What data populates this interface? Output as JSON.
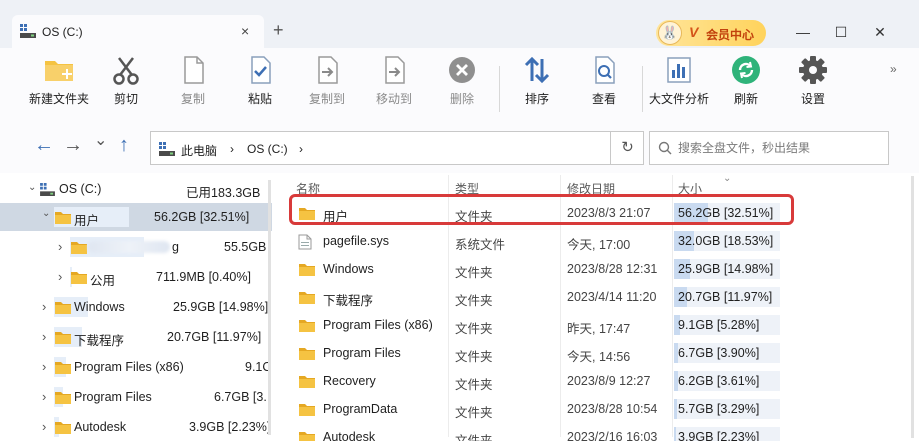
{
  "tab": {
    "title": "OS (C:)",
    "close": "×",
    "new_tab": "+"
  },
  "vip": {
    "rabbit": "🐰",
    "v": "V",
    "label": "会员中心"
  },
  "window": {
    "minimize": "—",
    "maximize": "☐",
    "close": "✕"
  },
  "toolbar": {
    "items": [
      {
        "label": "新建文件夹",
        "icon": "new-folder-icon",
        "enabled": true
      },
      {
        "label": "剪切",
        "icon": "scissors-icon",
        "enabled": true
      },
      {
        "label": "复制",
        "icon": "copy-icon",
        "enabled": false
      },
      {
        "label": "粘贴",
        "icon": "paste-icon",
        "enabled": true
      },
      {
        "label": "复制到",
        "icon": "copy-to-icon",
        "enabled": false
      },
      {
        "label": "移动到",
        "icon": "move-to-icon",
        "enabled": false
      },
      {
        "label": "删除",
        "icon": "delete-icon",
        "enabled": false
      },
      {
        "label": "排序",
        "icon": "sort-icon",
        "enabled": true
      },
      {
        "label": "查看",
        "icon": "view-icon",
        "enabled": true
      },
      {
        "label": "大文件分析",
        "icon": "chart-icon",
        "enabled": true
      },
      {
        "label": "刷新",
        "icon": "refresh-icon",
        "enabled": true
      },
      {
        "label": "设置",
        "icon": "gear-icon",
        "enabled": true
      }
    ],
    "more": "»"
  },
  "nav": {
    "back": "←",
    "forward": "→",
    "history": "⌄",
    "up": "↑"
  },
  "address": {
    "crumbs": [
      "此电脑",
      "OS (C:)"
    ],
    "separator": "›",
    "refresh": "↻"
  },
  "search": {
    "placeholder": "搜索全盘文件，秒出结果"
  },
  "tree": {
    "root": {
      "name": "OS (C:)",
      "used": "已用183.3GB"
    },
    "items": [
      {
        "name": "用户",
        "size": "56.2GB [32.51%]",
        "fill": 0.3251,
        "selected": true,
        "expanded": true,
        "level": 1
      },
      {
        "name": "g",
        "size": "55.5GB",
        "fill": 0.321,
        "level": 2,
        "blurred": true
      },
      {
        "name": "公用",
        "size": "711.9MB [0.40%]",
        "fill": 0.004,
        "level": 2
      },
      {
        "name": "Windows",
        "size": "25.9GB [14.98%]",
        "fill": 0.1498,
        "level": 1
      },
      {
        "name": "下载程序",
        "size": "20.7GB [11.97%]",
        "fill": 0.1197,
        "level": 1
      },
      {
        "name": "Program Files (x86)",
        "size": "9.1C",
        "fill": 0.0528,
        "level": 1
      },
      {
        "name": "Program Files",
        "size": "6.7GB [3.",
        "fill": 0.039,
        "level": 1
      },
      {
        "name": "Autodesk",
        "size": "3.9GB [2.23%]",
        "fill": 0.0223,
        "level": 1
      }
    ]
  },
  "list": {
    "headers": {
      "name": "名称",
      "type": "类型",
      "modified": "修改日期",
      "size": "大小"
    },
    "sort_indicator": "⌄",
    "rows": [
      {
        "name": "用户",
        "type": "文件夹",
        "modified": "2023/8/3 21:07",
        "size": "56.2GB [32.51%]",
        "fill": 0.3251,
        "icon": "folder-icon"
      },
      {
        "name": "pagefile.sys",
        "type": "系统文件",
        "modified": "今天, 17:00",
        "size": "32.0GB [18.53%]",
        "fill": 0.1853,
        "icon": "file-icon"
      },
      {
        "name": "Windows",
        "type": "文件夹",
        "modified": "2023/8/28 12:31",
        "size": "25.9GB [14.98%]",
        "fill": 0.1498,
        "icon": "folder-icon"
      },
      {
        "name": "下载程序",
        "type": "文件夹",
        "modified": "2023/4/14 11:20",
        "size": "20.7GB [11.97%]",
        "fill": 0.1197,
        "icon": "folder-icon"
      },
      {
        "name": "Program Files (x86)",
        "type": "文件夹",
        "modified": "昨天, 17:47",
        "size": "9.1GB [5.28%]",
        "fill": 0.0528,
        "icon": "folder-icon"
      },
      {
        "name": "Program Files",
        "type": "文件夹",
        "modified": "今天, 14:56",
        "size": "6.7GB [3.90%]",
        "fill": 0.039,
        "icon": "folder-icon"
      },
      {
        "name": "Recovery",
        "type": "文件夹",
        "modified": "2023/8/9 12:27",
        "size": "6.2GB [3.61%]",
        "fill": 0.0361,
        "icon": "folder-icon"
      },
      {
        "name": "ProgramData",
        "type": "文件夹",
        "modified": "2023/8/28 10:54",
        "size": "5.7GB [3.29%]",
        "fill": 0.0329,
        "icon": "folder-icon"
      },
      {
        "name": "Autodesk",
        "type": "文件夹",
        "modified": "2023/2/16 16:03",
        "size": "3.9GB [2.23%]",
        "fill": 0.0223,
        "icon": "folder-icon"
      }
    ]
  },
  "colors": {
    "accent": "#3d6fb4",
    "folder": "#f5c342",
    "highlight_border": "#d83a3a",
    "size_bar": "#c9daf0"
  }
}
